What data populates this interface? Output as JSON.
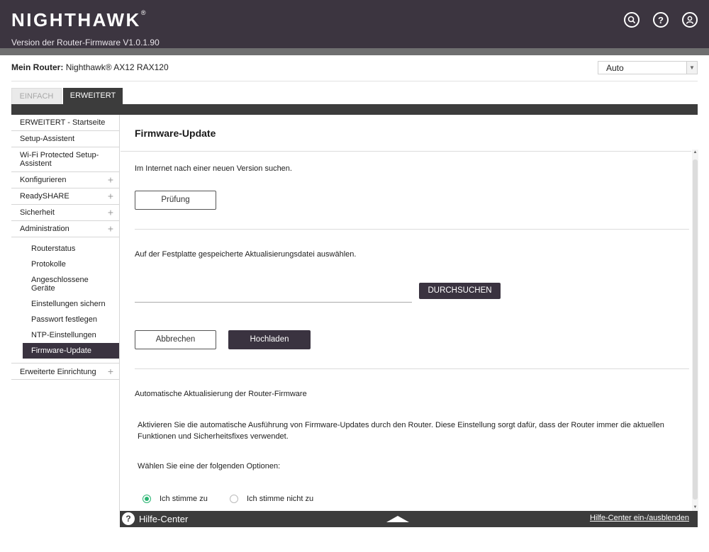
{
  "header": {
    "logo": "NIGHTHAWK",
    "logo_mark": "®",
    "firmware_version": "Version der Router-Firmware V1.0.1.90"
  },
  "router": {
    "label": "Mein Router:",
    "name": "Nighthawk® AX12 RAX120",
    "language_select": "Auto"
  },
  "tabs": [
    {
      "label": "EINFACH",
      "active": false
    },
    {
      "label": "ERWEITERT",
      "active": true
    }
  ],
  "sidebar": {
    "items": [
      {
        "label": "ERWEITERT - Startseite"
      },
      {
        "label": "Setup-Assistent"
      },
      {
        "label": "Wi-Fi Protected Setup-\nAssistent"
      },
      {
        "label": "Konfigurieren",
        "expand": "+"
      },
      {
        "label": "ReadySHARE",
        "expand": "+"
      },
      {
        "label": "Sicherheit",
        "expand": "+"
      },
      {
        "label": "Administration",
        "expand": "+"
      },
      {
        "label": "Erweiterte Einrichtung",
        "expand": "+"
      }
    ],
    "sub_items": [
      {
        "label": "Routerstatus"
      },
      {
        "label": "Protokolle"
      },
      {
        "label": "Angeschlossene\nGeräte"
      },
      {
        "label": "Einstellungen sichern"
      },
      {
        "label": "Passwort festlegen"
      },
      {
        "label": "NTP-Einstellungen"
      },
      {
        "label": "Firmware-Update"
      }
    ]
  },
  "main": {
    "title": "Firmware-Update",
    "check_text": "Im Internet nach einer neuen Version suchen.",
    "check_button": "Prüfung",
    "file_text": "Auf der Festplatte gespeicherte Aktualisierungsdatei auswählen.",
    "browse_button": "DURCHSUCHEN",
    "cancel_button": "Abbrechen",
    "upload_button": "Hochladen",
    "auto_title": "Automatische Aktualisierung der Router-Firmware",
    "auto_desc": "Aktivieren Sie die automatische Ausführung von Firmware-Updates durch den Router. Diese Einstellung sorgt dafür, dass der Router immer die aktuellen Funktionen und Sicherheitsfixes verwendet.",
    "options_prompt": "Wählen Sie eine der folgenden Optionen:",
    "options": [
      {
        "label": "Ich stimme zu",
        "selected": true
      },
      {
        "label": "Ich stimme nicht zu",
        "selected": false
      }
    ]
  },
  "help": {
    "icon": "?",
    "title": "Hilfe-Center",
    "toggle": "Hilfe-Center ein-/ausblenden"
  },
  "colors": {
    "header_bg": "#3c3540",
    "accent_dark": "#3a3340",
    "radio_on": "#2bb573"
  }
}
